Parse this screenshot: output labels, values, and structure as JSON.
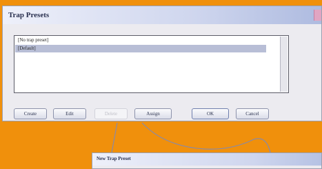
{
  "dialog": {
    "title": "Trap Presets",
    "list_items": [
      "[No trap preset]",
      "[Default]"
    ],
    "selected_index": 1,
    "buttons": {
      "create": "Create",
      "edit": "Edit",
      "delete": "Delete",
      "assign": "Assign",
      "ok": "OK",
      "cancel": "Cancel"
    }
  },
  "secondary_dialog": {
    "title": "New Trap Preset"
  }
}
